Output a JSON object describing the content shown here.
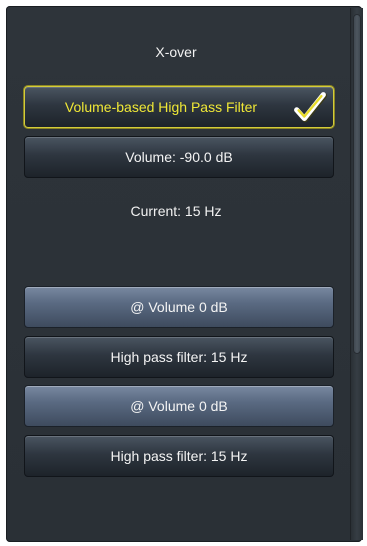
{
  "panel": {
    "title": "X-over",
    "current_label": "Current: 15 Hz"
  },
  "buttons": {
    "volume_hpf": {
      "label": "Volume-based High Pass Filter",
      "checked": true
    },
    "volume": {
      "label": "Volume: -90.0 dB"
    },
    "at_volume_1": {
      "label": "@ Volume 0 dB"
    },
    "hpf_1": {
      "label": "High pass filter: 15 Hz"
    },
    "at_volume_2": {
      "label": "@ Volume 0 dB"
    },
    "hpf_2": {
      "label": "High pass filter: 15 Hz"
    }
  },
  "icons": {
    "check": "check-icon"
  },
  "colors": {
    "panel_bg": "#2e343a",
    "selected_text": "#f0e836",
    "selected_border": "#d4cc3a",
    "check_white": "#ffffff",
    "check_yellow": "#e8dc2a"
  }
}
